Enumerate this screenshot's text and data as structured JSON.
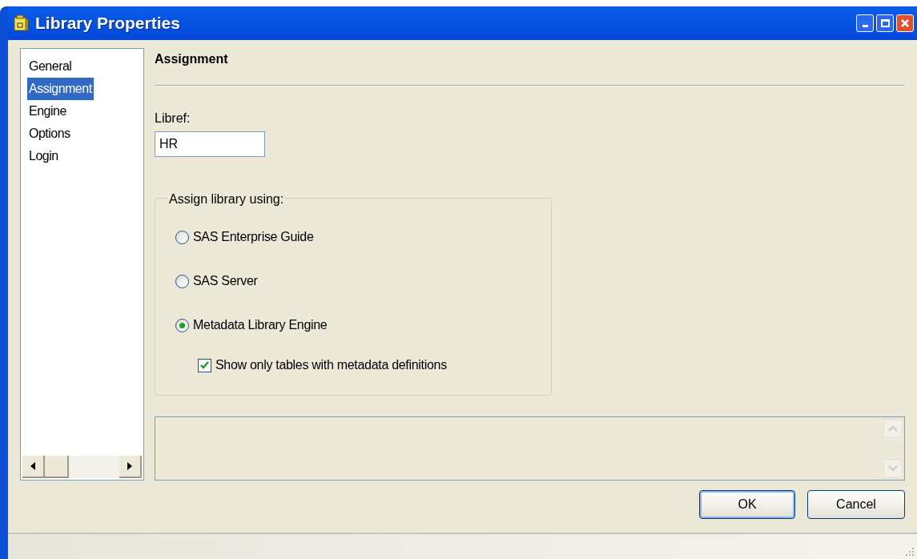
{
  "window": {
    "title": "Library Properties"
  },
  "sidebar": {
    "items": [
      {
        "label": "General",
        "selected": false
      },
      {
        "label": "Assignment",
        "selected": true
      },
      {
        "label": "Engine",
        "selected": false
      },
      {
        "label": "Options",
        "selected": false
      },
      {
        "label": "Login",
        "selected": false
      }
    ]
  },
  "panel": {
    "heading": "Assignment",
    "libref": {
      "label": "Libref:",
      "value": "HR"
    },
    "group": {
      "legend": "Assign library using:",
      "options": [
        {
          "label": "SAS Enterprise Guide",
          "selected": false
        },
        {
          "label": "SAS Server",
          "selected": false
        },
        {
          "label": "Metadata Library Engine",
          "selected": true
        }
      ],
      "checkbox": {
        "label": "Show only tables with metadata definitions",
        "checked": true
      }
    }
  },
  "buttons": [
    {
      "label": "OK",
      "default": true
    },
    {
      "label": "Cancel",
      "default": false
    }
  ]
}
